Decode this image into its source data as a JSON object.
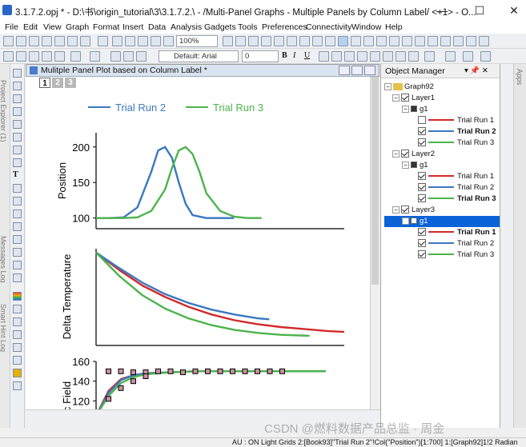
{
  "window": {
    "title": "3.1.7.2.opj * - D:\\书\\origin_tutorial\\3\\3.1.7.2.\\ - /Multi-Panel Graphs - Multiple Panels by Column Label/ <+1> - O...",
    "min": "—",
    "max": "☐",
    "close": "✕"
  },
  "menu": [
    "File",
    "Edit",
    "View",
    "Graph",
    "Format",
    "Insert",
    "Data",
    "Analysis",
    "Gadgets",
    "Tools",
    "Preferences",
    "Connectivity",
    "Window",
    "Help"
  ],
  "toolbar": {
    "zoom": "100%",
    "font": "Default: Arial",
    "size": "0",
    "bold": "B",
    "italic": "I",
    "underline": "U"
  },
  "side_tabs": [
    "Project Explorer (1)",
    "Messages Log",
    "Smart Hint Log"
  ],
  "apps_tab": "Apps",
  "graph_window": {
    "title": "Mulitple Panel Plot based on Column Label *",
    "layers": [
      "1",
      "2",
      "3"
    ]
  },
  "legend": {
    "items": [
      {
        "label": "Trial Run 2",
        "color": "#3a78c0"
      },
      {
        "label": "Trial Run 3",
        "color": "#4db34d"
      }
    ]
  },
  "object_manager": {
    "title": "Object Manager",
    "pin": "▾ 📌 ✕",
    "tree": {
      "root": "Graph92",
      "layers": [
        {
          "name": "Layer1",
          "group": "g1",
          "plots": [
            {
              "label": "Trial Run 1",
              "color": "#d12a2a",
              "checked": false,
              "bold": false
            },
            {
              "label": "Trial Run 2",
              "color": "#3a78c0",
              "checked": true,
              "bold": true
            },
            {
              "label": "Trial Run 3",
              "color": "#4db34d",
              "checked": true,
              "bold": false
            }
          ]
        },
        {
          "name": "Layer2",
          "group": "g1",
          "plots": [
            {
              "label": "Trial Run 1",
              "color": "#d12a2a",
              "checked": true,
              "bold": false
            },
            {
              "label": "Trial Run 2",
              "color": "#3a78c0",
              "checked": true,
              "bold": false
            },
            {
              "label": "Trial Run 3",
              "color": "#4db34d",
              "checked": true,
              "bold": true
            }
          ]
        },
        {
          "name": "Layer3",
          "group": "g1",
          "selected": true,
          "plots": [
            {
              "label": "Trial Run 1",
              "color": "#d12a2a",
              "checked": true,
              "bold": true
            },
            {
              "label": "Trial Run 2",
              "color": "#3a78c0",
              "checked": true,
              "bold": false
            },
            {
              "label": "Trial Run 3",
              "color": "#4db34d",
              "checked": true,
              "bold": false
            }
          ]
        }
      ]
    }
  },
  "status": "AU : ON  Light Grids  2:[Book93]\"Trial Run 2\"!Col(\"Position\")[1:700]  1:[Graph92]1!2  Radian",
  "watermark": "CSDN @燃料数据产品总监 · 周金 ",
  "chart_data": [
    {
      "type": "line",
      "ylabel": "Position",
      "yticks": [
        100,
        150,
        200
      ],
      "ylim": [
        85,
        220
      ],
      "series": [
        {
          "name": "Trial Run 2",
          "color": "#3a78c0",
          "x": [
            0,
            10,
            20,
            30,
            40,
            45,
            50,
            55,
            60,
            65,
            70,
            80,
            90,
            100
          ],
          "y": [
            100,
            100,
            101,
            115,
            165,
            195,
            200,
            185,
            150,
            120,
            104,
            100,
            100,
            100
          ]
        },
        {
          "name": "Trial Run 3",
          "color": "#4db34d",
          "x": [
            0,
            20,
            30,
            40,
            50,
            55,
            60,
            65,
            70,
            75,
            80,
            90,
            100,
            110,
            120
          ],
          "y": [
            100,
            100,
            101,
            110,
            140,
            170,
            195,
            200,
            190,
            165,
            135,
            110,
            102,
            100,
            100
          ]
        }
      ]
    },
    {
      "type": "line",
      "ylabel": "Delta Temperature",
      "ylim": [
        0,
        1
      ],
      "series": [
        {
          "name": "Trial Run 1",
          "color": "#d12a2a",
          "x": [
            0,
            20,
            40,
            60,
            80,
            100,
            120,
            140,
            160,
            180,
            200,
            215
          ],
          "y": [
            0.96,
            0.78,
            0.62,
            0.5,
            0.4,
            0.32,
            0.26,
            0.22,
            0.19,
            0.17,
            0.15,
            0.14
          ]
        },
        {
          "name": "Trial Run 2",
          "color": "#3a78c0",
          "x": [
            0,
            20,
            40,
            60,
            80,
            100,
            120,
            140,
            150
          ],
          "y": [
            0.96,
            0.8,
            0.65,
            0.53,
            0.44,
            0.37,
            0.32,
            0.28,
            0.27
          ]
        },
        {
          "name": "Trial Run 3",
          "color": "#4db34d",
          "x": [
            0,
            20,
            40,
            60,
            80,
            100,
            120,
            140,
            160,
            185
          ],
          "y": [
            0.96,
            0.72,
            0.52,
            0.38,
            0.28,
            0.21,
            0.16,
            0.13,
            0.11,
            0.1
          ]
        }
      ]
    },
    {
      "type": "line",
      "ylabel": "c Field",
      "yticks": [
        120,
        140,
        160
      ],
      "ylim": [
        100,
        160
      ],
      "series": [
        {
          "name": "Trial Run 1",
          "color": "#d12a2a",
          "x": [
            0,
            10,
            20,
            30,
            40,
            60,
            80,
            100,
            120,
            140,
            160,
            185
          ],
          "y": [
            105,
            130,
            142,
            146,
            148,
            149,
            150,
            150,
            150,
            150,
            150,
            150
          ]
        },
        {
          "name": "Trial Run 2",
          "color": "#3a78c0",
          "x": [
            0,
            10,
            20,
            30,
            40,
            60,
            80,
            100,
            120,
            140,
            160,
            185
          ],
          "y": [
            105,
            128,
            141,
            146,
            148,
            149,
            150,
            150,
            150,
            150,
            150,
            150
          ]
        },
        {
          "name": "Trial Run 3",
          "color": "#4db34d",
          "x": [
            0,
            10,
            20,
            30,
            40,
            60,
            80,
            100,
            120,
            140,
            160,
            185
          ],
          "y": [
            105,
            125,
            138,
            144,
            147,
            149,
            150,
            150,
            150,
            150,
            150,
            150
          ]
        }
      ],
      "markers": {
        "x": [
          10,
          20,
          30,
          40,
          50,
          60,
          70,
          80,
          90,
          100,
          110,
          120,
          130,
          140,
          150
        ],
        "y": [
          150,
          150,
          149,
          149,
          150,
          150,
          149,
          150,
          150,
          150,
          150,
          150,
          150,
          150,
          150
        ]
      },
      "markers2": {
        "x": [
          10,
          20,
          30,
          40
        ],
        "y": [
          122,
          133,
          140,
          145
        ]
      }
    }
  ]
}
